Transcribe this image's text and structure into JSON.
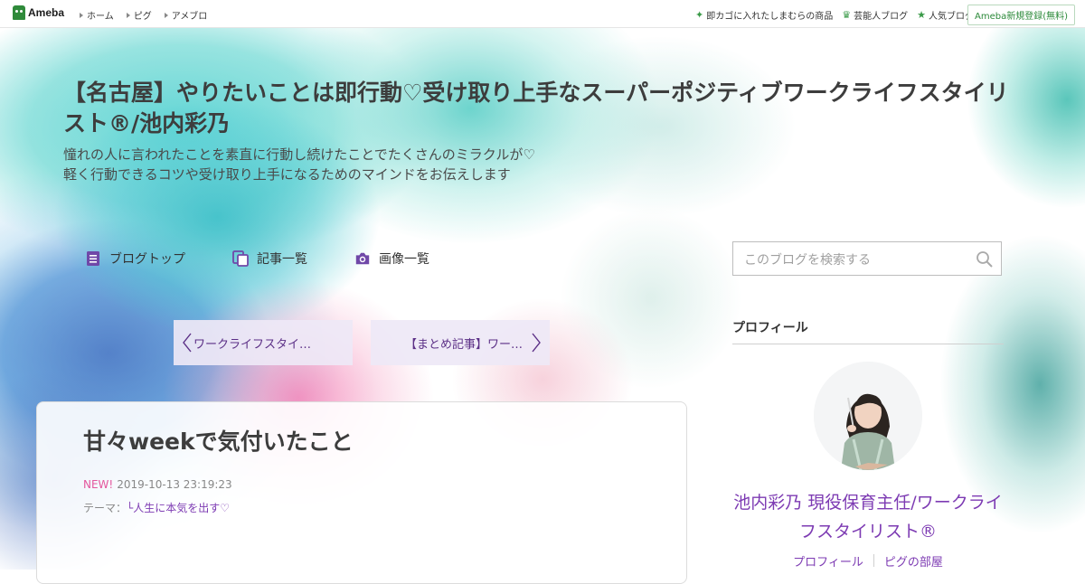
{
  "topbar": {
    "logo": "Ameba",
    "nav": [
      "ホーム",
      "ピグ",
      "アメブロ"
    ],
    "right_links": [
      {
        "icon": "sparkle-icon",
        "label": "即カゴに入れたしまむらの商品"
      },
      {
        "icon": "crown-icon",
        "label": "芸能人ブログ"
      },
      {
        "icon": "star-icon",
        "label": "人気ブログ"
      }
    ],
    "signup": "Ameba新規登録(無料)"
  },
  "header": {
    "title": "【名古屋】やりたいことは即行動♡受け取り上手なスーパーポジティブワークライフスタイリスト®/池内彩乃",
    "description_line1": "憧れの人に言われたことを素直に行動し続けたことでたくさんのミラクルが♡",
    "description_line2": "軽く行動できるコツや受け取り上手になるためのマインドをお伝えします"
  },
  "blognav": {
    "items": [
      {
        "icon": "document-icon",
        "label": "ブログトップ"
      },
      {
        "icon": "copy-icon",
        "label": "記事一覧"
      },
      {
        "icon": "camera-icon",
        "label": "画像一覧"
      }
    ]
  },
  "pager": {
    "prev": "ワークライフスタイ…",
    "next": "【まとめ記事】ワー…"
  },
  "article": {
    "title": "甘々weekで気付いたこと",
    "new_badge": "NEW!",
    "date": "2019-10-13 23:19:23",
    "theme_label": "テーマ：",
    "theme": "└人生に本気を出す♡"
  },
  "sidebar": {
    "search_placeholder": "このブログを検索する",
    "profile_heading": "プロフィール",
    "profile_name": "池内彩乃 現役保育主任/ワークライフスタイリスト®",
    "profile_links": [
      "プロフィール",
      "ピグの部屋"
    ]
  },
  "colors": {
    "accent": "#7d3bb3",
    "new_badge": "#e4569d",
    "ameba_green": "#2f8a3a"
  }
}
